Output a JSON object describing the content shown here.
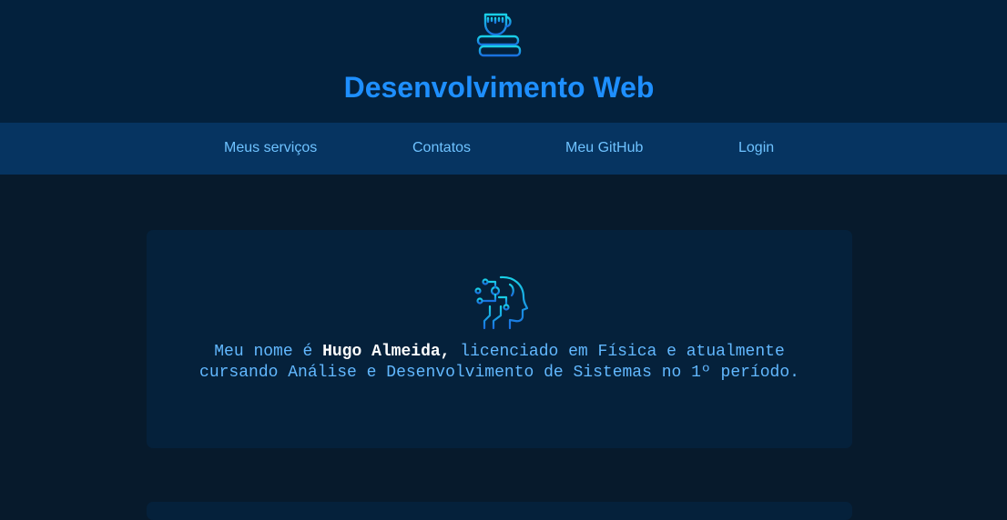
{
  "header": {
    "logo_icon": "coffee-cup-on-books-icon",
    "title": "Desenvolvimento Web"
  },
  "nav": {
    "items": [
      {
        "label": "Meus serviços"
      },
      {
        "label": "Contatos"
      },
      {
        "label": "Meu GitHub"
      },
      {
        "label": "Login"
      }
    ]
  },
  "bio": {
    "icon": "ai-head-circuit-icon",
    "prefix": "Meu nome é ",
    "name": "Hugo Almeida,",
    "suffix": " licenciado em Física e atualmente cursando Análise e Desenvolvimento de Sistemas no 1º período."
  },
  "colors": {
    "header_bg": "#03213d",
    "nav_bg": "#063461",
    "page_bg": "#071a2c",
    "card_bg": "#05213b",
    "accent": "#1e8fff",
    "nav_text": "#6ec2ff",
    "body_text": "#62b8ff"
  }
}
